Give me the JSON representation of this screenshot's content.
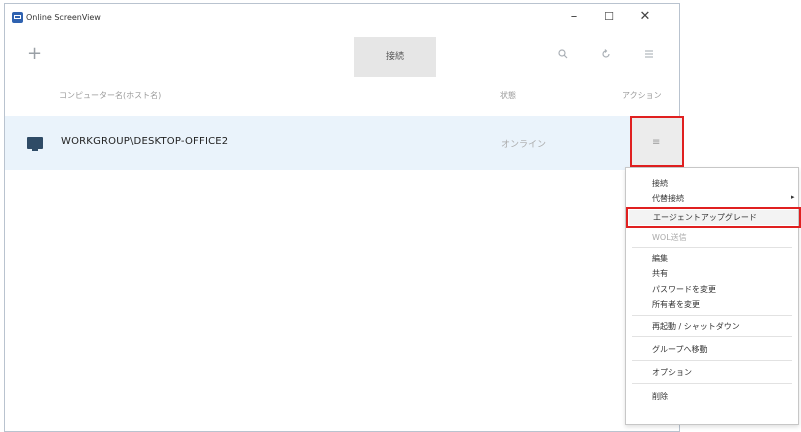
{
  "window": {
    "title": "Online ScreenView",
    "minimize": "–",
    "maximize": "☐",
    "close": "✕"
  },
  "toolbar": {
    "add": "+",
    "connect": "接続",
    "search_icon": "search-icon",
    "refresh_icon": "refresh-icon",
    "menu_icon": "menu-icon"
  },
  "table": {
    "headers": {
      "name": "コンピューター名(ホスト名)",
      "status": "状態",
      "action": "アクション"
    },
    "rows": [
      {
        "name": "WORKGROUP\\DESKTOP-OFFICE2",
        "status": "オンライン",
        "action": "≡"
      }
    ]
  },
  "context_menu": {
    "items": [
      {
        "label": "接続",
        "disabled": false
      },
      {
        "label": "代替接続",
        "disabled": false,
        "submenu": "▸"
      },
      {
        "label": "エージェントアップグレード",
        "disabled": false,
        "highlighted": true
      },
      {
        "label": "WOL送信",
        "disabled": true
      },
      {
        "label": "編集",
        "disabled": false
      },
      {
        "label": "共有",
        "disabled": false
      },
      {
        "label": "パスワードを変更",
        "disabled": false
      },
      {
        "label": "所有者を変更",
        "disabled": false
      },
      {
        "label": "再起動 / シャットダウン",
        "disabled": false
      },
      {
        "label": "グループへ移動",
        "disabled": false
      },
      {
        "label": "オプション",
        "disabled": false
      },
      {
        "label": "削除",
        "disabled": false
      }
    ]
  },
  "colors": {
    "highlight_border": "#e02020",
    "row_background": "#eaf3fb",
    "app_accent": "#2f62b0"
  }
}
